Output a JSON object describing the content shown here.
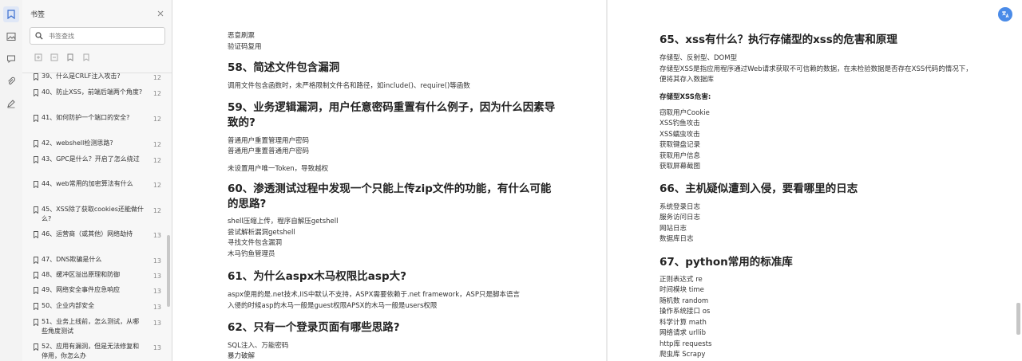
{
  "panel": {
    "title": "书签",
    "search_placeholder": "书签查找"
  },
  "bookmarks": [
    {
      "label": "39、什么是CRLF注入攻击?",
      "page": "12"
    },
    {
      "label": "40、防止XSS，前端后端两个角度?",
      "page": "12"
    },
    {
      "label": "41、如何防护一个端口的安全?",
      "page": "12"
    },
    {
      "label": "42、webshell检测思路?",
      "page": "12"
    },
    {
      "label": "43、GPC是什么？开启了怎么绕过",
      "page": "12"
    },
    {
      "label": "44、web常用的加密算法有什么",
      "page": "12"
    },
    {
      "label": "45、XSS除了获取cookies还能做什么?",
      "page": "12"
    },
    {
      "label": "46、运营商（或其他）网络劫持",
      "page": "13"
    },
    {
      "label": "47、DNS欺骗是什么",
      "page": "13"
    },
    {
      "label": "48、缓冲区溢出原理和防御",
      "page": "13"
    },
    {
      "label": "49、网络安全事件应急响应",
      "page": "13"
    },
    {
      "label": "50、企业内部安全",
      "page": "13"
    },
    {
      "label": "51、业务上线前，怎么测试，从哪些角度测试",
      "page": "13"
    },
    {
      "label": "52、应用有漏洞，但是无法修复和停用，你怎么办",
      "page": "13"
    }
  ],
  "left_page": {
    "pre": [
      "恶意刷票",
      "验证码复用"
    ],
    "s58": {
      "heading": "58、简述文件包含漏洞",
      "text": "调用文件包含函数时，未严格限制文件名和路径，如include()、require()等函数"
    },
    "s59": {
      "heading1": "59、业务逻辑漏洞，用户任意密码重置有什么例子，因为什么因素导",
      "heading2": "致的?",
      "lines": [
        "普通用户重置管理用户密码",
        "普通用户重置普通用户密码",
        "未设置用户唯一Token，导致越权"
      ]
    },
    "s60": {
      "heading1": "60、渗透测试过程中发现一个只能上传zip文件的功能，有什么可能",
      "heading2": "的思路?",
      "lines": [
        "shell压缩上传，程序自解压getshell",
        "尝试解析漏洞getshell",
        "寻找文件包含漏洞",
        "木马钓鱼管理员"
      ]
    },
    "s61": {
      "heading": "61、为什么aspx木马权限比asp大?",
      "lines": [
        "aspx使用的是.net技术,IIS中默认不支持，ASP只是脚本语言入侵的时候asp的木马一般是guest权限APSX的木马一般是users权限"
      ],
      "line1": "aspx使用的是.net技术,IIS中默认不支持，ASPX需要依赖于.net framework，ASP只是脚本语言",
      "line2": "入侵的时候asp的木马一般是guest权限APSX的木马一般是users权限"
    },
    "s62": {
      "heading": "62、只有一个登录页面有哪些思路?",
      "lines": [
        "SQL注入、万能密码",
        "暴力破解"
      ]
    }
  },
  "right_page": {
    "s65": {
      "heading": "65、xss有什么？执行存储型的xss的危害和原理",
      "lines": [
        "存储型、反射型、DOM型",
        "存储型XSS是指应用程序通过Web请求获取不可信赖的数据，在未检验数据是否存在XSS代码的情况下，",
        "便将其存入数据库"
      ],
      "sub": "存储型XSS危害:",
      "items": [
        "窃取用户Cookie",
        "XSS钓鱼攻击",
        "XSS蠕虫攻击",
        "获取键盘记录",
        "获取用户信息",
        "获取屏幕截图"
      ]
    },
    "s66": {
      "heading": "66、主机疑似遭到入侵，要看哪里的日志",
      "lines": [
        "系统登录日志",
        "服务访问日志",
        "网站日志",
        "数据库日志"
      ]
    },
    "s67": {
      "heading": "67、python常用的标准库",
      "lines": [
        "正则表达式 re",
        "时间模块 time",
        "随机数 random",
        "操作系统接口 os",
        "科学计算 math",
        "网络请求 urllib",
        "http库 requests",
        "爬虫库 Scrapy"
      ]
    }
  },
  "colors": {
    "accent": "#4a8be8",
    "text": "#333333",
    "heading": "#222222"
  }
}
